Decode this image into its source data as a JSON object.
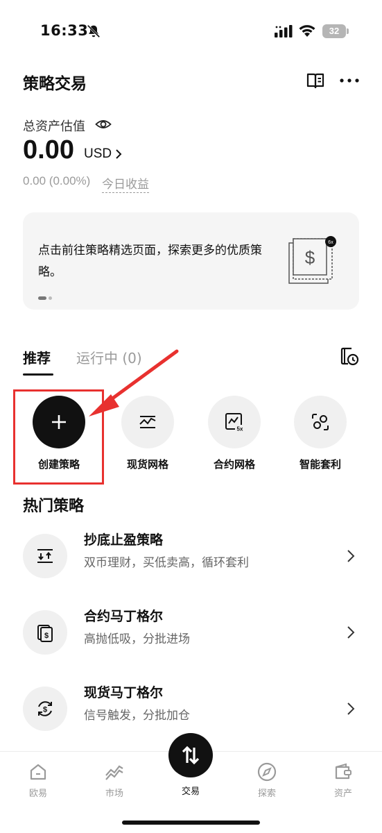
{
  "status_bar": {
    "time": "16:33",
    "battery": "32"
  },
  "header": {
    "title": "策略交易"
  },
  "assets": {
    "label": "总资产估值",
    "value": "0.00",
    "unit": "USD",
    "change": "0.00 (0.00%)",
    "today_label": "今日收益"
  },
  "banner": {
    "text": "点击前往策略精选页面，探索更多的优质策略。",
    "badge": "6x"
  },
  "tabs": [
    {
      "label": "推荐",
      "active": true
    },
    {
      "label": "运行中 (0)",
      "active": false
    }
  ],
  "quick_actions": [
    {
      "label": "创建策略",
      "icon": "plus-icon"
    },
    {
      "label": "现货网格",
      "icon": "grid-chart-icon"
    },
    {
      "label": "合约网格",
      "icon": "leverage-grid-icon",
      "badge": "5x"
    },
    {
      "label": "智能套利",
      "icon": "arbitrage-icon"
    }
  ],
  "hot_section": {
    "title": "热门策略"
  },
  "strategies": [
    {
      "title": "抄底止盈策略",
      "desc": "双币理财，买低卖高，循环套利",
      "icon": "buy-low-icon"
    },
    {
      "title": "合约马丁格尔",
      "desc": "高抛低吸，分批进场",
      "icon": "futures-martingale-icon"
    },
    {
      "title": "现货马丁格尔",
      "desc": "信号触发，分批加仓",
      "icon": "spot-martingale-icon"
    }
  ],
  "bottom_nav": [
    {
      "label": "欧易",
      "icon": "home-icon"
    },
    {
      "label": "市场",
      "icon": "market-icon"
    },
    {
      "label": "交易",
      "icon": "trade-icon",
      "active": true
    },
    {
      "label": "探索",
      "icon": "compass-icon"
    },
    {
      "label": "资产",
      "icon": "wallet-icon"
    }
  ],
  "colors": {
    "highlight": "#e8312f",
    "primary": "#111111",
    "muted": "#9a9a9a"
  }
}
